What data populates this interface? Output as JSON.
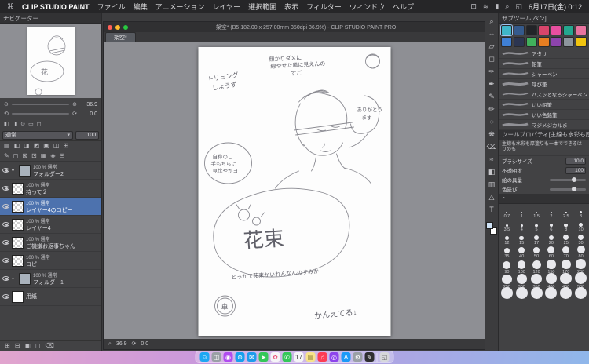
{
  "menu_bar": {
    "apple_icon": "⌘",
    "items": [
      "CLIP STUDIO PAINT",
      "ファイル",
      "編集",
      "アニメーション",
      "レイヤー",
      "選択範囲",
      "表示",
      "フィルター",
      "ウィンドウ",
      "ヘルプ"
    ],
    "status_icons": [
      {
        "name": "display-icon",
        "glyph": "⊡"
      },
      {
        "name": "wifi-icon",
        "glyph": "≋"
      },
      {
        "name": "battery-icon",
        "glyph": "▮"
      },
      {
        "name": "search-icon",
        "glyph": "⌕"
      },
      {
        "name": "control-center-icon",
        "glyph": "◱"
      }
    ],
    "clock": "6月17日(金) 0:12"
  },
  "navigator": {
    "title": "ナビゲーター",
    "zoom_value": "36.9",
    "rotation_value": "0.0",
    "zoom_out_icon": "⊖",
    "zoom_in_icon": "⊕",
    "rotate_left_icon": "⟲",
    "rotate_right_icon": "⟳",
    "fit_icons": [
      "◧",
      "◨",
      "⊙",
      "▭",
      "◻"
    ]
  },
  "layer_panel": {
    "blend_mode": "通常",
    "dropdown_icon": "▾",
    "opacity_value": "100",
    "folder_arrow": "▾",
    "toolbar_row1": [
      "▤",
      "◧",
      "◨",
      "◩",
      "▣",
      "◫",
      "⊞"
    ],
    "toolbar_row2": [
      "✎",
      "◻",
      "⊠",
      "⊡",
      "▦",
      "◈",
      "⊟"
    ],
    "footer_icons": [
      "⊞",
      "⊟",
      "▣",
      "◻",
      "⌫"
    ],
    "layers": [
      {
        "info": "100 % 通常",
        "name": "フォルダー2"
      },
      {
        "info": "100 % 通常",
        "name": "持って２"
      },
      {
        "info": "100 % 通常",
        "name": "レイヤー4のコピー"
      },
      {
        "info": "100 % 通常",
        "name": "レイヤー4"
      },
      {
        "info": "100 % 通常",
        "name": "ご機嫌お返事ちゃん"
      },
      {
        "info": "100 % 通常",
        "name": "コピー"
      },
      {
        "info": "100 % 通常",
        "name": "フォルダー1"
      },
      {
        "info": "",
        "name": "用紙"
      }
    ]
  },
  "document": {
    "window_title": "架空* (B5 182.00 x 257.00mm 350dpi 36.9%) - CLIP STUDIO PAINT PRO",
    "tab_label": "架空*",
    "status_zoom": "36.9",
    "status_rotation": "0.0",
    "status_zoom_icon": "⌕",
    "status_rotate_icon": "⟳"
  },
  "sketch": {
    "annotations": [
      {
        "text": "トリミング"
      },
      {
        "text": "しようず"
      },
      {
        "text": "顔かりダメに"
      },
      {
        "text": "線やせた風に見えんの"
      },
      {
        "text": "すご"
      },
      {
        "text": "ありがとう"
      },
      {
        "text": "ます"
      },
      {
        "text": "自称のこ"
      },
      {
        "text": "手もちらに"
      },
      {
        "text": "見比やがヨ"
      },
      {
        "text": "花束"
      },
      {
        "text": "どっかで花束かいれんなんのすみか"
      },
      {
        "text": "かんえてる↓"
      },
      {
        "text": "車"
      }
    ]
  },
  "tools": {
    "strip": [
      {
        "name": "zoom-tool",
        "glyph": "⌕"
      },
      {
        "name": "move-tool",
        "glyph": "⇔"
      },
      {
        "name": "operation-tool",
        "glyph": "▱"
      },
      {
        "name": "selection-tool",
        "glyph": "◻"
      },
      {
        "name": "eyedropper-tool",
        "glyph": "✑"
      },
      {
        "name": "pen-tool",
        "glyph": "✒"
      },
      {
        "name": "pencil-tool",
        "glyph": "✎"
      },
      {
        "name": "brush-tool",
        "glyph": "✏"
      },
      {
        "name": "airbrush-tool",
        "glyph": "◌"
      },
      {
        "name": "decoration-tool",
        "glyph": "❋"
      },
      {
        "name": "eraser-tool",
        "glyph": "⌫"
      },
      {
        "name": "blend-tool",
        "glyph": "≈"
      },
      {
        "name": "fill-tool",
        "glyph": "◧"
      },
      {
        "name": "gradient-tool",
        "glyph": "▥"
      },
      {
        "name": "figure-tool",
        "glyph": "△"
      },
      {
        "name": "text-tool",
        "glyph": "T"
      }
    ]
  },
  "subtool": {
    "title": "サブツール[ペン]",
    "presets": [
      {
        "name": "preset-1",
        "color": "#3fb6c9"
      },
      {
        "name": "preset-2",
        "color": "#355a8c"
      },
      {
        "name": "preset-3",
        "color": "#222428"
      },
      {
        "name": "preset-4",
        "color": "#d8456b"
      },
      {
        "name": "preset-5",
        "color": "#e84fa0"
      },
      {
        "name": "preset-6",
        "color": "#25a78f"
      },
      {
        "name": "preset-7",
        "color": "#e8739f"
      },
      {
        "name": "preset-8",
        "color": "#3f7fd4"
      },
      {
        "name": "preset-9",
        "color": "#2c3550"
      },
      {
        "name": "preset-10",
        "color": "#41b05c"
      },
      {
        "name": "preset-11",
        "color": "#e67e22"
      },
      {
        "name": "preset-12",
        "color": "#8e44ad"
      },
      {
        "name": "preset-13",
        "color": "#8d959d"
      },
      {
        "name": "preset-14",
        "color": "#f1c40f"
      }
    ],
    "brushes": [
      {
        "label": "アタリ"
      },
      {
        "label": "鉛筆"
      },
      {
        "label": "シャーペン"
      },
      {
        "label": "呼び筆"
      },
      {
        "label": "パスッとなるシャーペン"
      },
      {
        "label": "いい鉛筆"
      },
      {
        "label": "いい色鉛筆"
      },
      {
        "label": "マジメジカルま"
      }
    ]
  },
  "tool_property": {
    "title": "ツールプロパティ[主線も水彩も厚塗りも]",
    "subtool_name": "主線も水彩も厚塗りも一本でできるはりのも",
    "properties": [
      {
        "label": "ブラシサイズ",
        "value": "10.0"
      },
      {
        "label": "不透明度",
        "value": "100"
      },
      {
        "label": "絵の具量",
        "value": ""
      },
      {
        "label": "色延び",
        "value": ""
      }
    ]
  },
  "brush_sizes": {
    "rows": [
      [
        "0.7",
        "1",
        "1.5",
        "2",
        "2.5",
        "3"
      ],
      [
        "3.5",
        "4",
        "5",
        "6",
        "8",
        "10"
      ],
      [
        "12",
        "15",
        "17",
        "20",
        "25",
        "30"
      ],
      [
        "35",
        "40",
        "50",
        "60",
        "70",
        "80"
      ],
      [
        "90",
        "100",
        "120",
        "150",
        "170",
        "200"
      ],
      [
        "250",
        "300",
        "350",
        "400",
        "450",
        "500"
      ]
    ]
  },
  "dock": {
    "apps": [
      {
        "name": "finder",
        "color": "#1ea7f2",
        "fg": "#ffffff",
        "glyph": "☺"
      },
      {
        "name": "launchpad",
        "color": "#9aa0a6",
        "fg": "#ffffff",
        "glyph": "◫"
      },
      {
        "name": "siri",
        "color": "#b14cf0",
        "fg": "#ffffff",
        "glyph": "◉"
      },
      {
        "name": "safari",
        "color": "#18a0ee",
        "fg": "#ffffff",
        "glyph": "⊛"
      },
      {
        "name": "mail",
        "color": "#1f9ced",
        "fg": "#ffffff",
        "glyph": "✉"
      },
      {
        "name": "maps",
        "color": "#34c759",
        "fg": "#ffffff",
        "glyph": "➤"
      },
      {
        "name": "photos",
        "color": "#f5f5f7",
        "fg": "#e8537a",
        "glyph": "✿"
      },
      {
        "name": "facetime",
        "color": "#34c759",
        "fg": "#ffffff",
        "glyph": "✆"
      },
      {
        "name": "calendar",
        "color": "#f5f5f7",
        "fg": "#333333",
        "glyph": "17"
      },
      {
        "name": "notes",
        "color": "#f7e38a",
        "fg": "#8a7a33",
        "glyph": "▤"
      },
      {
        "name": "music",
        "color": "#fc3c55",
        "fg": "#ffffff",
        "glyph": "♫"
      },
      {
        "name": "podcasts",
        "color": "#8e44ec",
        "fg": "#ffffff",
        "glyph": "◎"
      },
      {
        "name": "app-store",
        "color": "#1b9af7",
        "fg": "#ffffff",
        "glyph": "A"
      },
      {
        "name": "system-settings",
        "color": "#9aa0a6",
        "fg": "#ffffff",
        "glyph": "⚙"
      },
      {
        "name": "clip-studio",
        "color": "#2f2f31",
        "fg": "#ffffff",
        "glyph": "✎"
      },
      {
        "name": "trash",
        "color": "#d6d8db",
        "fg": "#666666",
        "glyph": "◱"
      }
    ]
  }
}
